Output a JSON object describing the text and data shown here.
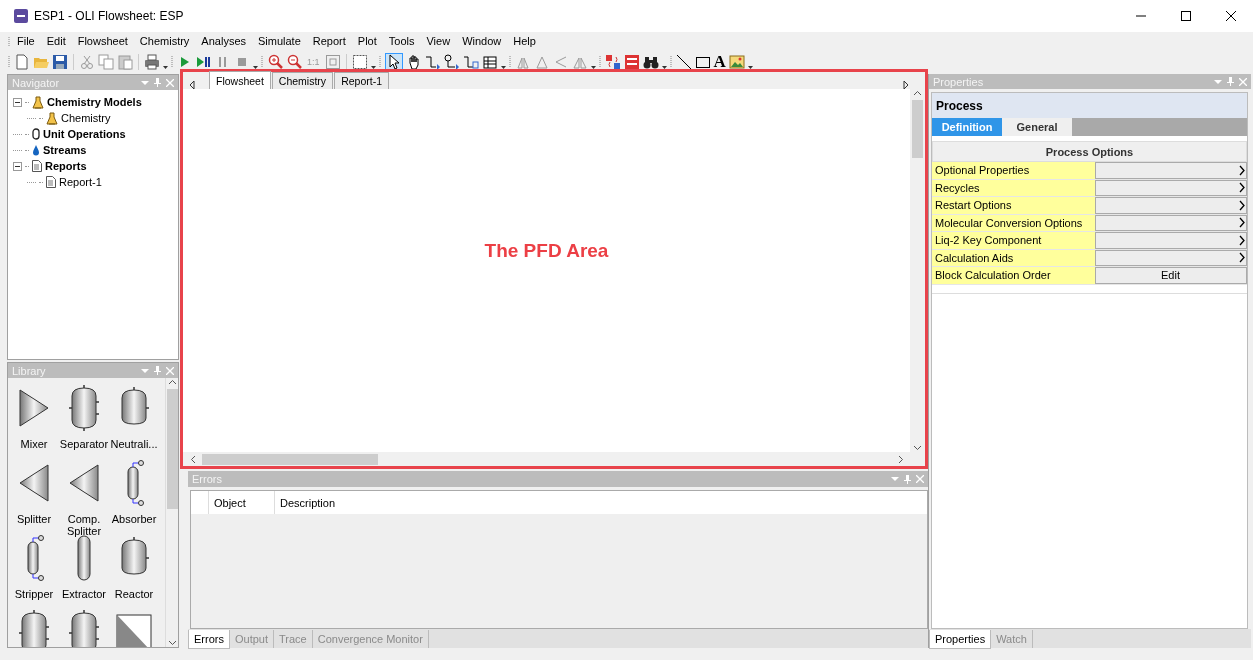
{
  "window": {
    "title": "ESP1 - OLI Flowsheet: ESP"
  },
  "menu": [
    "File",
    "Edit",
    "Flowsheet",
    "Chemistry",
    "Analyses",
    "Simulate",
    "Report",
    "Plot",
    "Tools",
    "View",
    "Window",
    "Help"
  ],
  "toolbar": {
    "zoom_label": "1:1",
    "text_tool": "A"
  },
  "navigator": {
    "title": "Navigator",
    "tree": [
      {
        "label": "Chemistry Models",
        "kind": "flask",
        "expanded": true,
        "children": [
          {
            "label": "Chemistry",
            "kind": "flask"
          }
        ]
      },
      {
        "label": "Unit Operations",
        "kind": "unit"
      },
      {
        "label": "Streams",
        "kind": "drop"
      },
      {
        "label": "Reports",
        "kind": "report",
        "expanded": true,
        "children": [
          {
            "label": "Report-1",
            "kind": "report"
          }
        ]
      }
    ]
  },
  "library": {
    "title": "Library",
    "items": [
      {
        "label": "Mixer",
        "kind": "triangle-right"
      },
      {
        "label": "Separator",
        "kind": "vessel"
      },
      {
        "label": "Neutrali...",
        "kind": "drum"
      },
      {
        "label": "Splitter",
        "kind": "triangle-left"
      },
      {
        "label": "Comp.\nSplitter",
        "kind": "triangle-left"
      },
      {
        "label": "Absorber",
        "kind": "column"
      },
      {
        "label": "Stripper",
        "kind": "column"
      },
      {
        "label": "Extractor",
        "kind": "tall-column"
      },
      {
        "label": "Reactor",
        "kind": "drum"
      },
      {
        "kind": "vessel"
      },
      {
        "kind": "vessel"
      },
      {
        "kind": "diagonal"
      }
    ]
  },
  "document_tabs": [
    {
      "label": "Flowsheet",
      "selected": true
    },
    {
      "label": "Chemistry",
      "selected": false
    },
    {
      "label": "Report-1",
      "selected": false
    }
  ],
  "annotation": {
    "text": "The PFD Area"
  },
  "properties": {
    "title": "Properties",
    "heading": "Process",
    "tabs": [
      {
        "label": "Definition",
        "selected": true
      },
      {
        "label": "General",
        "selected": false
      }
    ],
    "section": "Process Options",
    "rows": [
      {
        "label": "Optional Properties",
        "kind": "arrow"
      },
      {
        "label": "Recycles",
        "kind": "arrow"
      },
      {
        "label": "Restart Options",
        "kind": "arrow"
      },
      {
        "label": "Molecular Conversion Options",
        "kind": "arrow"
      },
      {
        "label": "Liq-2 Key Component",
        "kind": "arrow"
      },
      {
        "label": "Calculation Aids",
        "kind": "arrow"
      },
      {
        "label": "Block Calculation Order",
        "kind": "button",
        "button": "Edit"
      }
    ],
    "bottom_tabs": [
      {
        "label": "Properties",
        "selected": true
      },
      {
        "label": "Watch",
        "selected": false
      }
    ]
  },
  "errors": {
    "title": "Errors",
    "columns": [
      "Object",
      "Description"
    ],
    "bottom_tabs": [
      {
        "label": "Errors",
        "selected": true
      },
      {
        "label": "Output",
        "selected": false
      },
      {
        "label": "Trace",
        "selected": false
      },
      {
        "label": "Convergence Monitor",
        "selected": false
      }
    ]
  }
}
